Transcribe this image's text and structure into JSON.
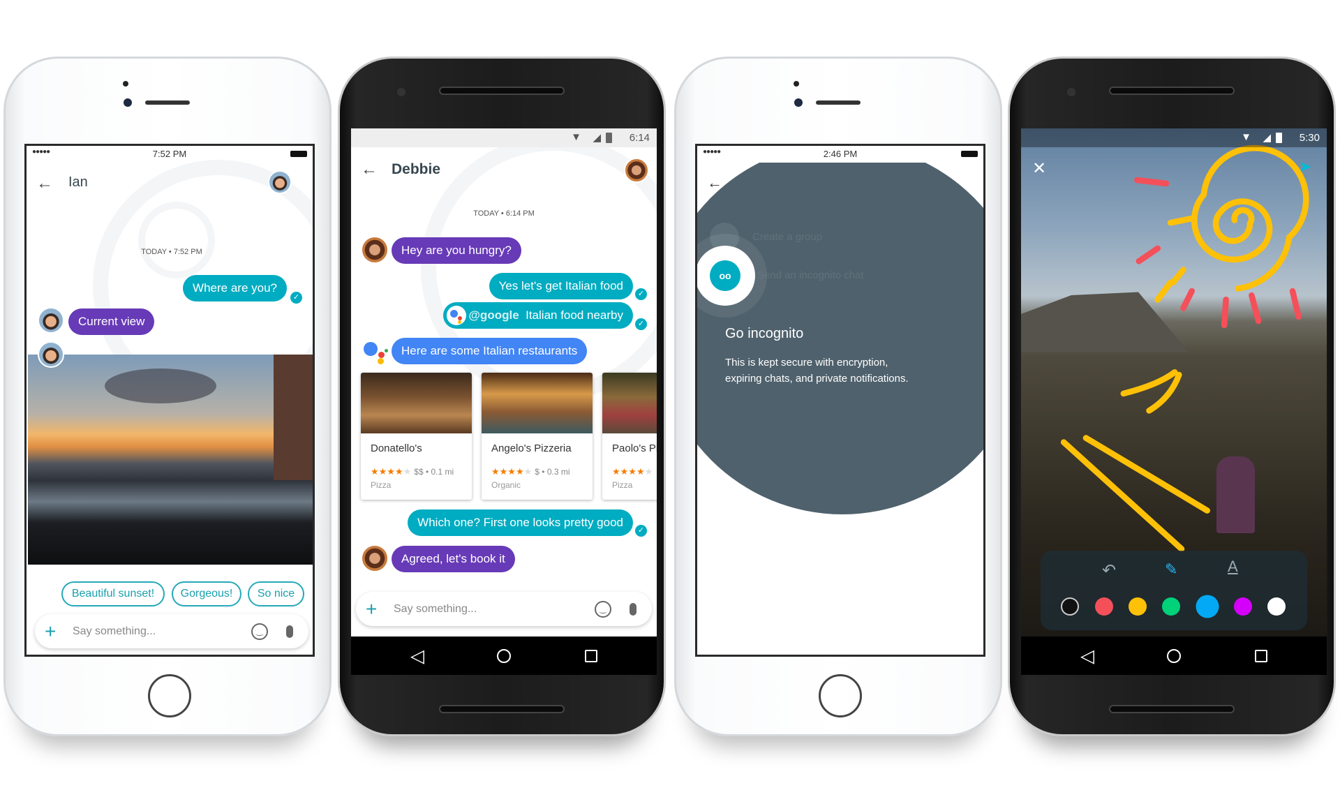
{
  "phone1": {
    "status_time": "7:52 PM",
    "signal": "●●●●●",
    "contact": "Ian",
    "timestamp": "TODAY • 7:52 PM",
    "messages": [
      {
        "text": "Where are you?",
        "side": "outgoing"
      },
      {
        "text": "Current view",
        "side": "incoming"
      }
    ],
    "smart_replies": [
      "Beautiful sunset!",
      "Gorgeous!",
      "So nice"
    ],
    "input_placeholder": "Say something..."
  },
  "phone2": {
    "status_time": "6:14",
    "contact": "Debbie",
    "timestamp": "TODAY • 6:14 PM",
    "messages": [
      {
        "text": "Hey are you hungry?",
        "side": "incoming"
      },
      {
        "text": "Yes let's get Italian food",
        "side": "outgoing"
      },
      {
        "mention": "@google",
        "text": "Italian food nearby",
        "side": "outgoing"
      },
      {
        "text": "Here are some Italian restaurants",
        "side": "assistant"
      },
      {
        "text": "Which one? First one looks pretty good",
        "side": "outgoing"
      },
      {
        "text": "Agreed, let's book it",
        "side": "incoming"
      }
    ],
    "restaurants": [
      {
        "name": "Donatello's",
        "stars": "★★★★",
        "empty_stars": "★",
        "meta": "$$ • 0.1 mi",
        "category": "Pizza",
        "rating": 4
      },
      {
        "name": "Angelo's Pizzeria",
        "stars": "★★★★",
        "empty_stars": "★",
        "meta": "$ • 0.3 mi",
        "category": "Organic",
        "rating": 4
      },
      {
        "name": "Paolo's Pizza",
        "stars": "★★★★",
        "empty_stars": "★",
        "meta": "",
        "category": "Pizza",
        "rating": 4
      }
    ],
    "input_placeholder": "Say something..."
  },
  "phone3": {
    "status_time": "2:46 PM",
    "signal": "●●●●●",
    "menu": [
      "Create a group",
      "Send an incognito chat"
    ],
    "title": "Go incognito",
    "description_line1": "This is kept secure with encryption,",
    "description_line2": "expiring chats, and private notifications."
  },
  "phone4": {
    "status_time": "5:30",
    "palette": [
      "#111111",
      "#f4505a",
      "#ffc107",
      "#00d27a",
      "#03a9f4",
      "#d500f9",
      "#ffffff"
    ],
    "selected_color": "#03a9f4",
    "drawing_color": "#ffc107"
  },
  "colors": {
    "incoming": "#673ab7",
    "outgoing": "#00acc1",
    "assistant": "#4285f4",
    "incognito": "#4f616c"
  }
}
